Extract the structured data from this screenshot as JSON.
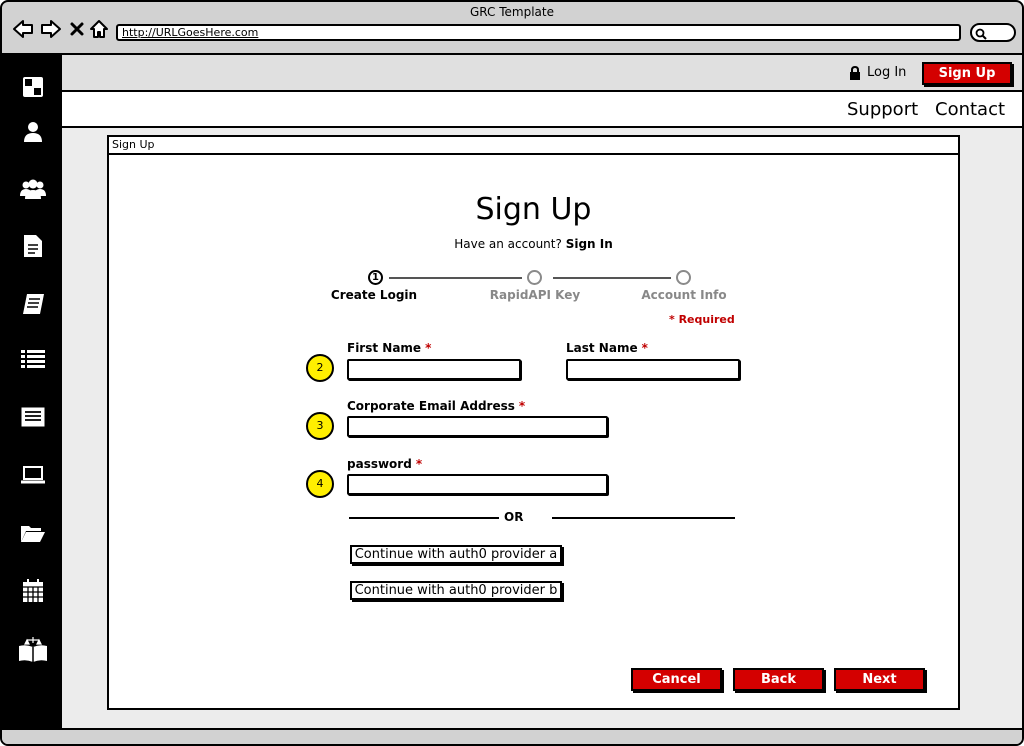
{
  "window": {
    "title": "GRC Template",
    "url": "http://URLGoesHere.com"
  },
  "header": {
    "login_label": "Log In",
    "signup_label": "Sign Up"
  },
  "nav": {
    "items": [
      "Support",
      "Contact"
    ]
  },
  "dialog": {
    "window_title": "Sign Up",
    "heading": "Sign Up",
    "have_account_text": "Have an account?",
    "sign_in_link": "Sign In",
    "steps": [
      {
        "number": "1",
        "label": "Create Login",
        "active": true
      },
      {
        "number": "",
        "label": "RapidAPI Key",
        "active": false
      },
      {
        "number": "",
        "label": "Account Info",
        "active": false
      }
    ],
    "required_note": "*  Required",
    "fields": {
      "first_name_label": "First Name",
      "last_name_label": "Last Name",
      "email_label": "Corporate Email Address",
      "password_label": "password",
      "required_marker": "*"
    },
    "callouts": [
      "2",
      "3",
      "4"
    ],
    "or_label": "OR",
    "auth_buttons": [
      "Continue with auth0 provider a",
      "Continue with auth0 provider b"
    ],
    "actions": {
      "cancel": "Cancel",
      "back": "Back",
      "next": "Next"
    }
  },
  "colors": {
    "accent": "#d40000",
    "required": "#c00000",
    "callout": "#ffef00"
  }
}
